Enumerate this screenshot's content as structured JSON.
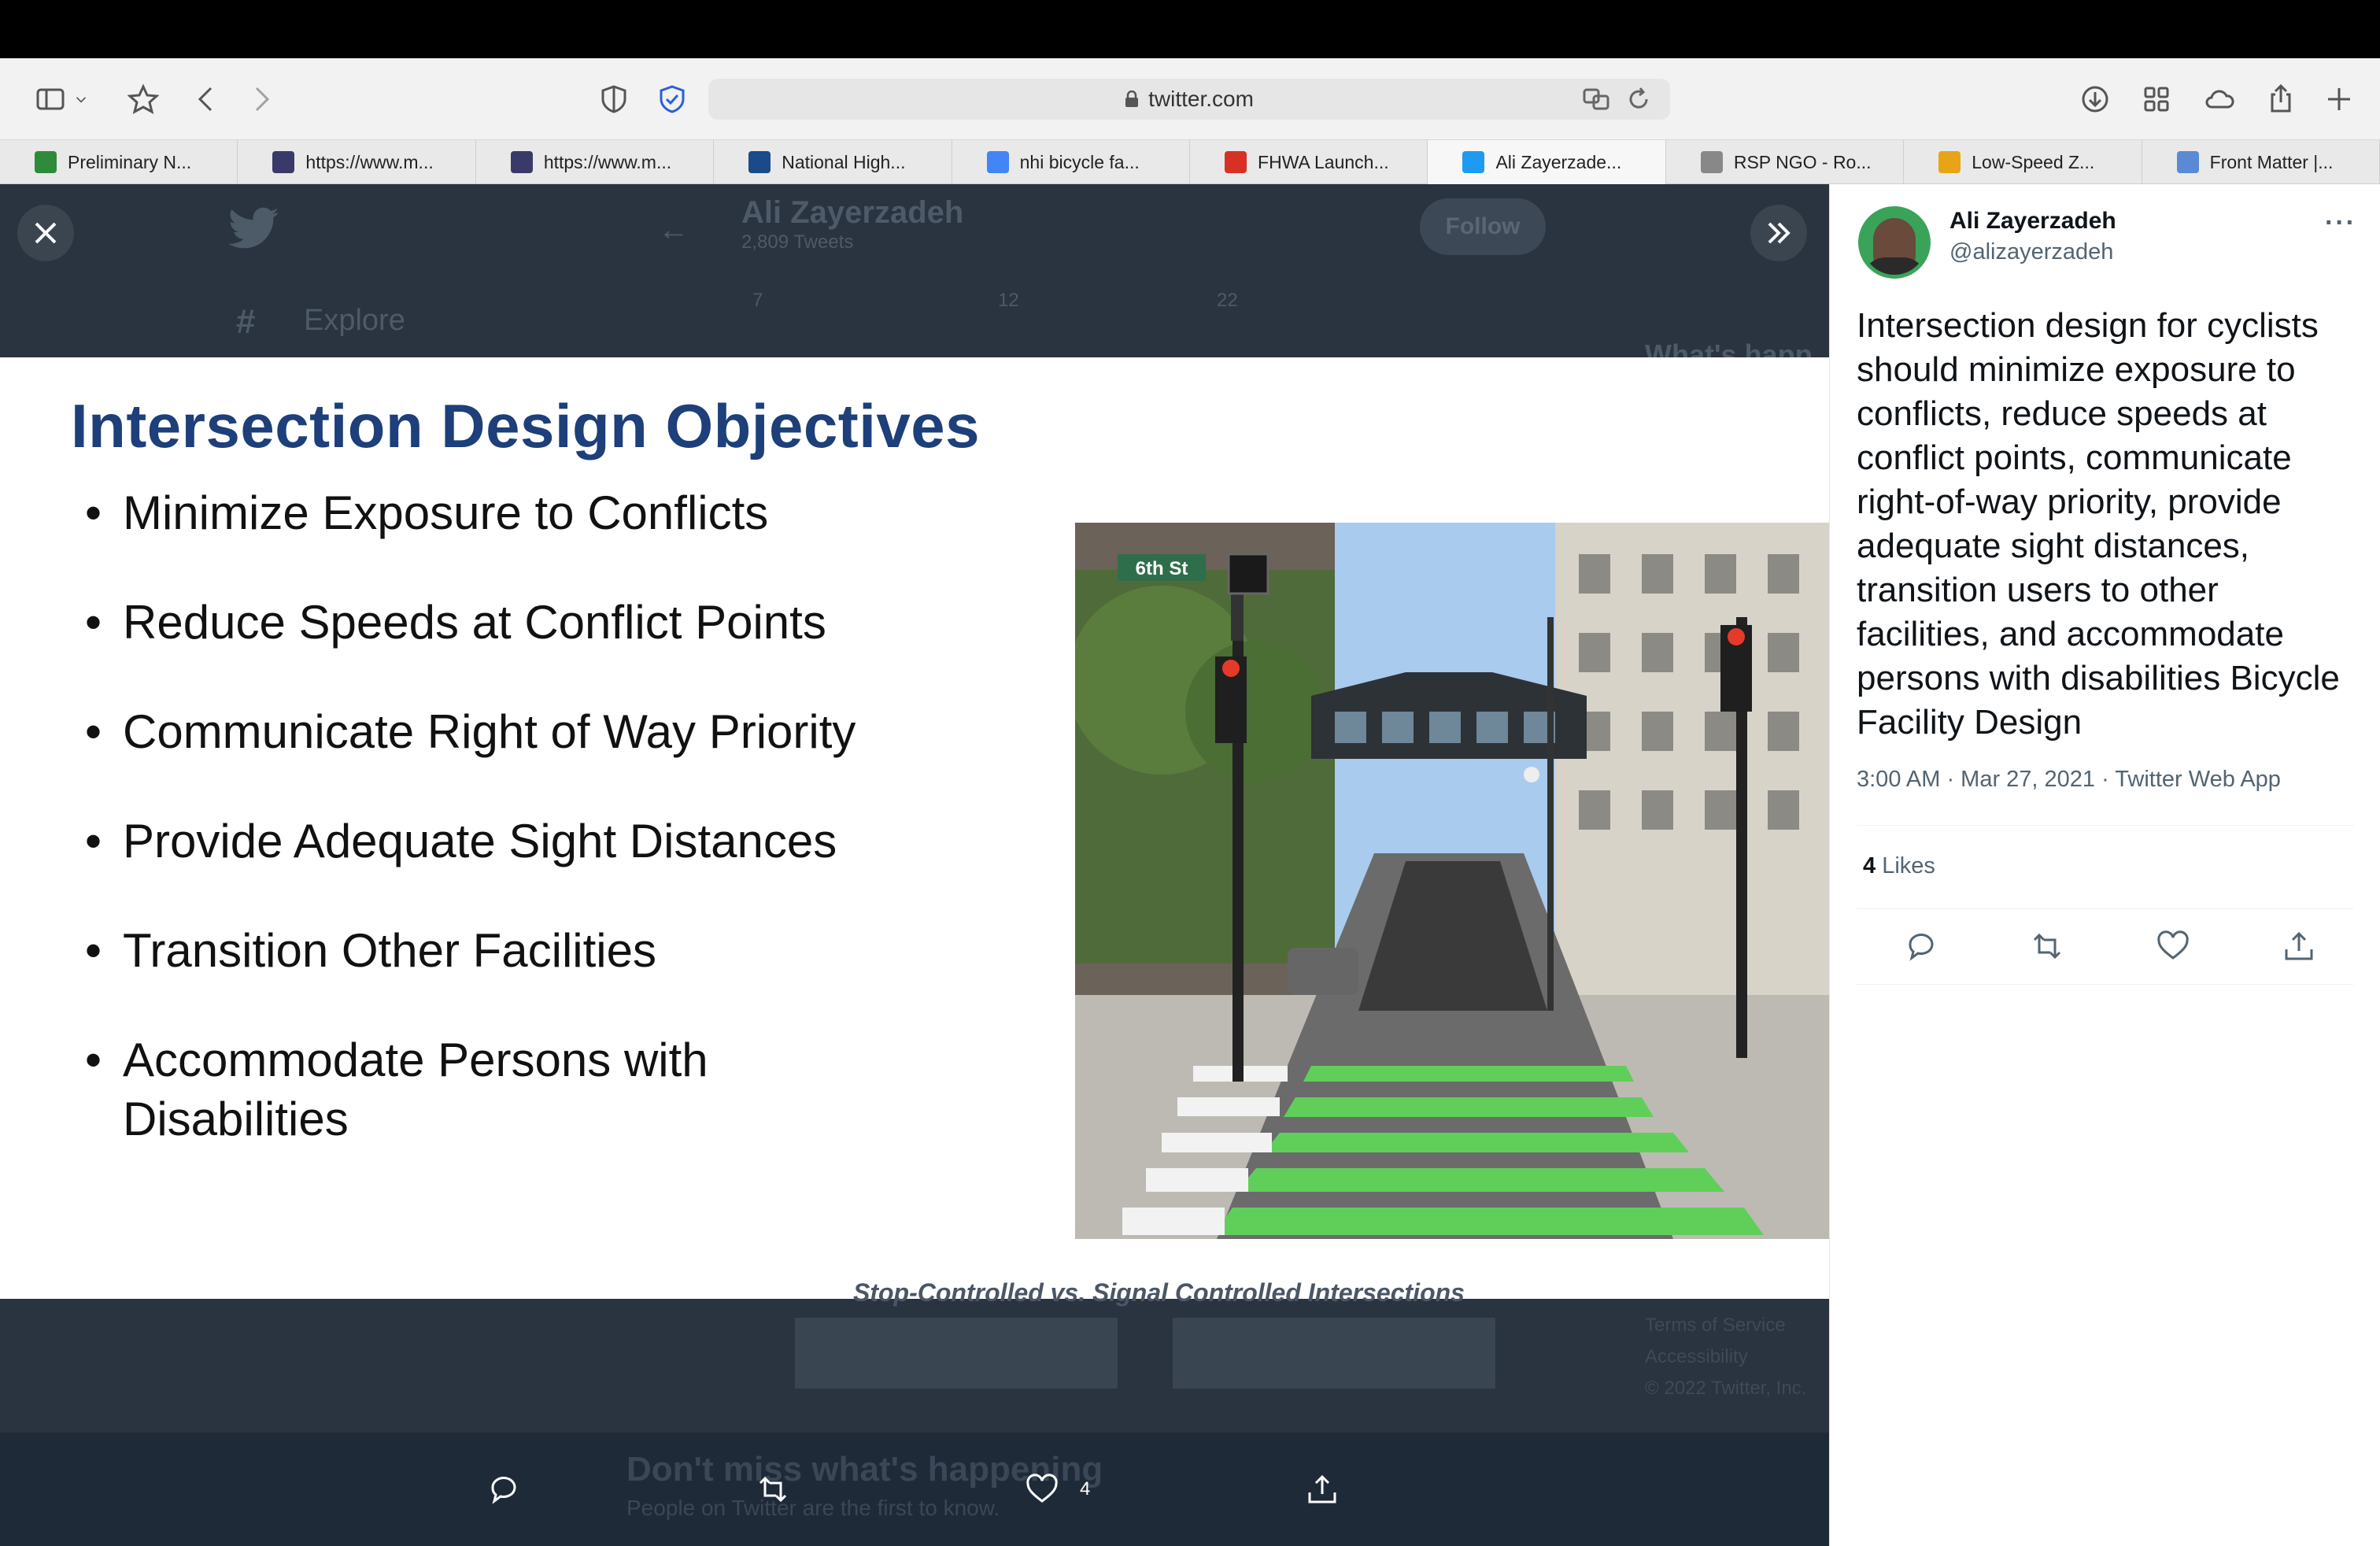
{
  "browser": {
    "url": "twitter.com",
    "tabs": [
      {
        "label": "Preliminary N...",
        "favicon_color": "#2e8b3a"
      },
      {
        "label": "https://www.m...",
        "favicon_color": "#3a3a6a"
      },
      {
        "label": "https://www.m...",
        "favicon_color": "#3a3a6a"
      },
      {
        "label": "National High...",
        "favicon_color": "#1a4a8a"
      },
      {
        "label": "nhi bicycle fa...",
        "favicon_color": "#4285f4"
      },
      {
        "label": "FHWA Launch...",
        "favicon_color": "#d93025"
      },
      {
        "label": "Ali Zayerzade...",
        "favicon_color": "#1d9bf0"
      },
      {
        "label": "RSP NGO - Ro...",
        "favicon_color": "#888888"
      },
      {
        "label": "Low-Speed Z...",
        "favicon_color": "#e8a317"
      },
      {
        "label": "Front Matter |...",
        "favicon_color": "#5a8ad6"
      }
    ],
    "active_tab": 6
  },
  "background": {
    "profile_name": "Ali Zayerzadeh",
    "tweet_count": "2,809 Tweets",
    "follow_label": "Follow",
    "explore_label": "Explore",
    "counts": {
      "replies": "7",
      "retweets": "12",
      "likes": "22"
    },
    "heading_partial": "What's happ",
    "footer": [
      "Terms of Service",
      "Accessibility",
      "© 2022 Twitter, Inc."
    ],
    "subcaption": "Stop-Controlled vs. Signal Controlled Intersections",
    "banner_title": "Don't miss what's happening",
    "banner_sub": "People on Twitter are the first to know."
  },
  "slide": {
    "title": "Intersection Design Objectives",
    "bullets": [
      "Minimize Exposure to Conflicts",
      "Reduce Speeds at Conflict Points",
      "Communicate Right of Way Priority",
      "Provide Adequate Sight Distances",
      "Transition Other Facilities",
      "Accommodate Persons with Disabilities"
    ],
    "street_sign": "6th St"
  },
  "media_actions": {
    "likes_count": "4"
  },
  "tweet": {
    "name": "Ali Zayerzadeh",
    "handle": "@alizayerzadeh",
    "text": "Intersection design for cyclists should minimize exposure to conflicts, reduce speeds at conflict points, communicate right-of-way priority, provide adequate sight distances, transition users to other facilities, and accommodate persons with disabilities Bicycle Facility Design",
    "meta": "3:00 AM · Mar 27, 2021 · Twitter Web App",
    "likes_count": "4",
    "likes_label": "Likes"
  }
}
